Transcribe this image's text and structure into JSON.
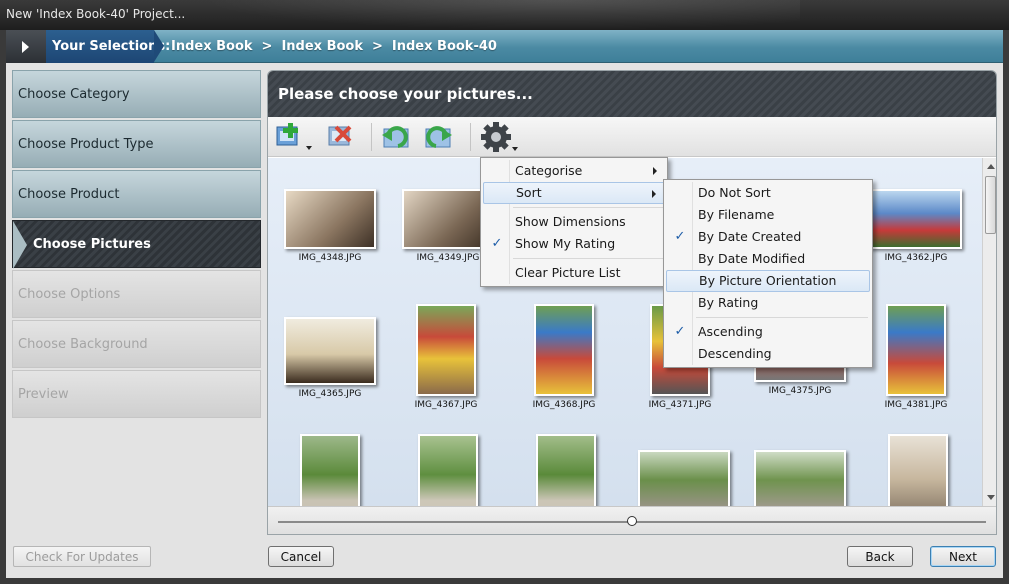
{
  "window": {
    "title": "New 'Index Book-40' Project..."
  },
  "breadcrumb": {
    "label": "Your Selections:",
    "items": [
      "Index Book",
      "Index Book",
      "Index Book-40"
    ],
    "separator": ">"
  },
  "nav": {
    "items": [
      {
        "label": "Choose Category",
        "state": "normal"
      },
      {
        "label": "Choose Product Type",
        "state": "normal"
      },
      {
        "label": "Choose Product",
        "state": "normal"
      },
      {
        "label": "Choose Pictures",
        "state": "active"
      },
      {
        "label": "Choose Options",
        "state": "disabled"
      },
      {
        "label": "Choose Background",
        "state": "disabled"
      },
      {
        "label": "Preview",
        "state": "disabled"
      }
    ]
  },
  "panel": {
    "title": "Please choose your pictures..."
  },
  "toolbar": {
    "buttons": [
      "add-pictures-icon",
      "remove-pictures-icon",
      "rotate-left-icon",
      "rotate-right-icon",
      "settings-gear-icon"
    ]
  },
  "gallery": {
    "thumbnails": [
      "IMG_4348.JPG",
      "IMG_4349.JPG",
      "IMG_4362.JPG",
      "IMG_4365.JPG",
      "IMG_4367.JPG",
      "IMG_4368.JPG",
      "IMG_4371.JPG",
      "IMG_4375.JPG",
      "IMG_4381.JPG"
    ]
  },
  "menu": {
    "items": [
      {
        "label": "Categorise",
        "submenu": true,
        "checked": false
      },
      {
        "label": "Sort",
        "submenu": true,
        "checked": false,
        "highlighted": true
      },
      {
        "label": "Show Dimensions",
        "submenu": false,
        "checked": false
      },
      {
        "label": "Show My Rating",
        "submenu": false,
        "checked": true
      },
      {
        "label": "Clear Picture List",
        "submenu": false,
        "checked": false
      }
    ]
  },
  "sort_menu": {
    "items": [
      {
        "label": "Do Not Sort",
        "checked": false
      },
      {
        "label": "By Filename",
        "checked": false
      },
      {
        "label": "By Date Created",
        "checked": true
      },
      {
        "label": "By Date Modified",
        "checked": false
      },
      {
        "label": "By Picture Orientation",
        "checked": false,
        "highlighted": true
      },
      {
        "label": "By Rating",
        "checked": false
      },
      {
        "label": "Ascending",
        "checked": true
      },
      {
        "label": "Descending",
        "checked": false
      }
    ]
  },
  "zoom": {
    "level": 0.5
  },
  "buttons": {
    "check_updates": "Check For Updates",
    "cancel": "Cancel",
    "back": "Back",
    "next": "Next"
  },
  "colors": {
    "breadcrumb_bg": "#4b8aa3",
    "nav_active": "#3a4046",
    "accent": "#1f5ea8"
  }
}
